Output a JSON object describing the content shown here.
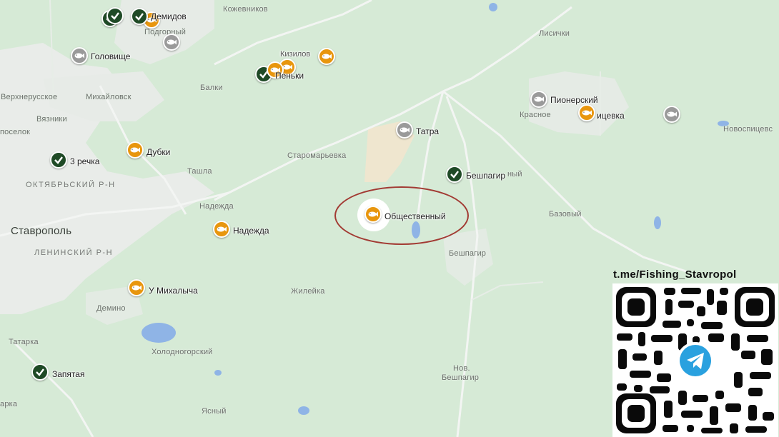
{
  "map": {
    "places": [
      {
        "id": "kozhevnikov",
        "text": "Кожевников"
      },
      {
        "id": "podgorny",
        "text": "Подгорный"
      },
      {
        "id": "verkhnerusskoe",
        "text": "Верхнерусское"
      },
      {
        "id": "mikhailovsk",
        "text": "Михайловск"
      },
      {
        "id": "balki",
        "text": "Балки"
      },
      {
        "id": "vyazniki",
        "text": "Вязники"
      },
      {
        "id": "poselok",
        "text": "поселок"
      },
      {
        "id": "staromaryevka",
        "text": "Старомарьевка"
      },
      {
        "id": "tashla",
        "text": "Ташла"
      },
      {
        "id": "oktyabrsky",
        "text": "ОКТЯБРЬСКИЙ Р-Н"
      },
      {
        "id": "nadezhda_town",
        "text": "Надежда"
      },
      {
        "id": "stavropol",
        "text": "Ставрополь"
      },
      {
        "id": "leninsky",
        "text": "ЛЕНИНСКИЙ Р-Н"
      },
      {
        "id": "demino",
        "text": "Демино"
      },
      {
        "id": "zhileika",
        "text": "Жилейка"
      },
      {
        "id": "tatarka",
        "text": "Татарка"
      },
      {
        "id": "kholodnogorsky",
        "text": "Холодногорский"
      },
      {
        "id": "arka",
        "text": "арка"
      },
      {
        "id": "yasny",
        "text": "Ясный"
      },
      {
        "id": "lisichki",
        "text": "Лисички"
      },
      {
        "id": "krasnoe",
        "text": "Красное"
      },
      {
        "id": "novospitsev",
        "text": "Новоспицевс"
      },
      {
        "id": "nyi",
        "text": "ный"
      },
      {
        "id": "bazovy",
        "text": "Базовый"
      },
      {
        "id": "beshpagir_town",
        "text": "Бешпагир"
      },
      {
        "id": "nov",
        "text": "Нов."
      },
      {
        "id": "nov_beshpagir",
        "text": "Бешпагир"
      }
    ],
    "markers": [
      {
        "id": "demidov",
        "type": "check",
        "label": "Демидов"
      },
      {
        "id": "demidov_2",
        "type": "check",
        "label": ""
      },
      {
        "id": "demidov_fish",
        "type": "fish-orange",
        "label": ""
      },
      {
        "id": "podgorny_pin",
        "type": "fish-gray",
        "label": ""
      },
      {
        "id": "golovishche",
        "type": "fish-gray",
        "label": "Головище"
      },
      {
        "id": "kizilov",
        "type": "fish-orange",
        "label": "Кизилов"
      },
      {
        "id": "penki",
        "type": "fish-orange",
        "label": "Пеньки"
      },
      {
        "id": "penki_2",
        "type": "fish-orange",
        "label": ""
      },
      {
        "id": "penki_check",
        "type": "check",
        "label": ""
      },
      {
        "id": "tatra",
        "type": "fish-gray",
        "label": "Татра"
      },
      {
        "id": "pionersky",
        "type": "fish-gray",
        "label": "Пионерский"
      },
      {
        "id": "spitsevka",
        "type": "fish-orange",
        "label": "ицевка"
      },
      {
        "id": "east_gray",
        "type": "fish-gray",
        "label": ""
      },
      {
        "id": "dubki",
        "type": "fish-orange",
        "label": "Дубки"
      },
      {
        "id": "tri_rechka",
        "type": "check",
        "label": "3 речка"
      },
      {
        "id": "beshpagir",
        "type": "check",
        "label": "Бешпагир"
      },
      {
        "id": "obshchestvenny",
        "type": "fish-orange",
        "label": "Общественный"
      },
      {
        "id": "nadezhda",
        "type": "fish-orange",
        "label": "Надежда"
      },
      {
        "id": "u_mikhalycha",
        "type": "fish-orange",
        "label": "У Михалыча"
      },
      {
        "id": "zapyataya",
        "type": "check",
        "label": "Запятая"
      }
    ]
  },
  "promo": {
    "channel": "t.me/Fishing_Stavropol",
    "qr_icon": "telegram-icon"
  },
  "colors": {
    "land": "#d6ead6",
    "urban": "#e9ece9",
    "water": "#8fb4e6",
    "fish_orange": "#e8960e",
    "fish_gray": "#9a9a9a",
    "check_green": "#1f4a26",
    "highlight": "#a23a33",
    "telegram": "#2aa1df"
  }
}
